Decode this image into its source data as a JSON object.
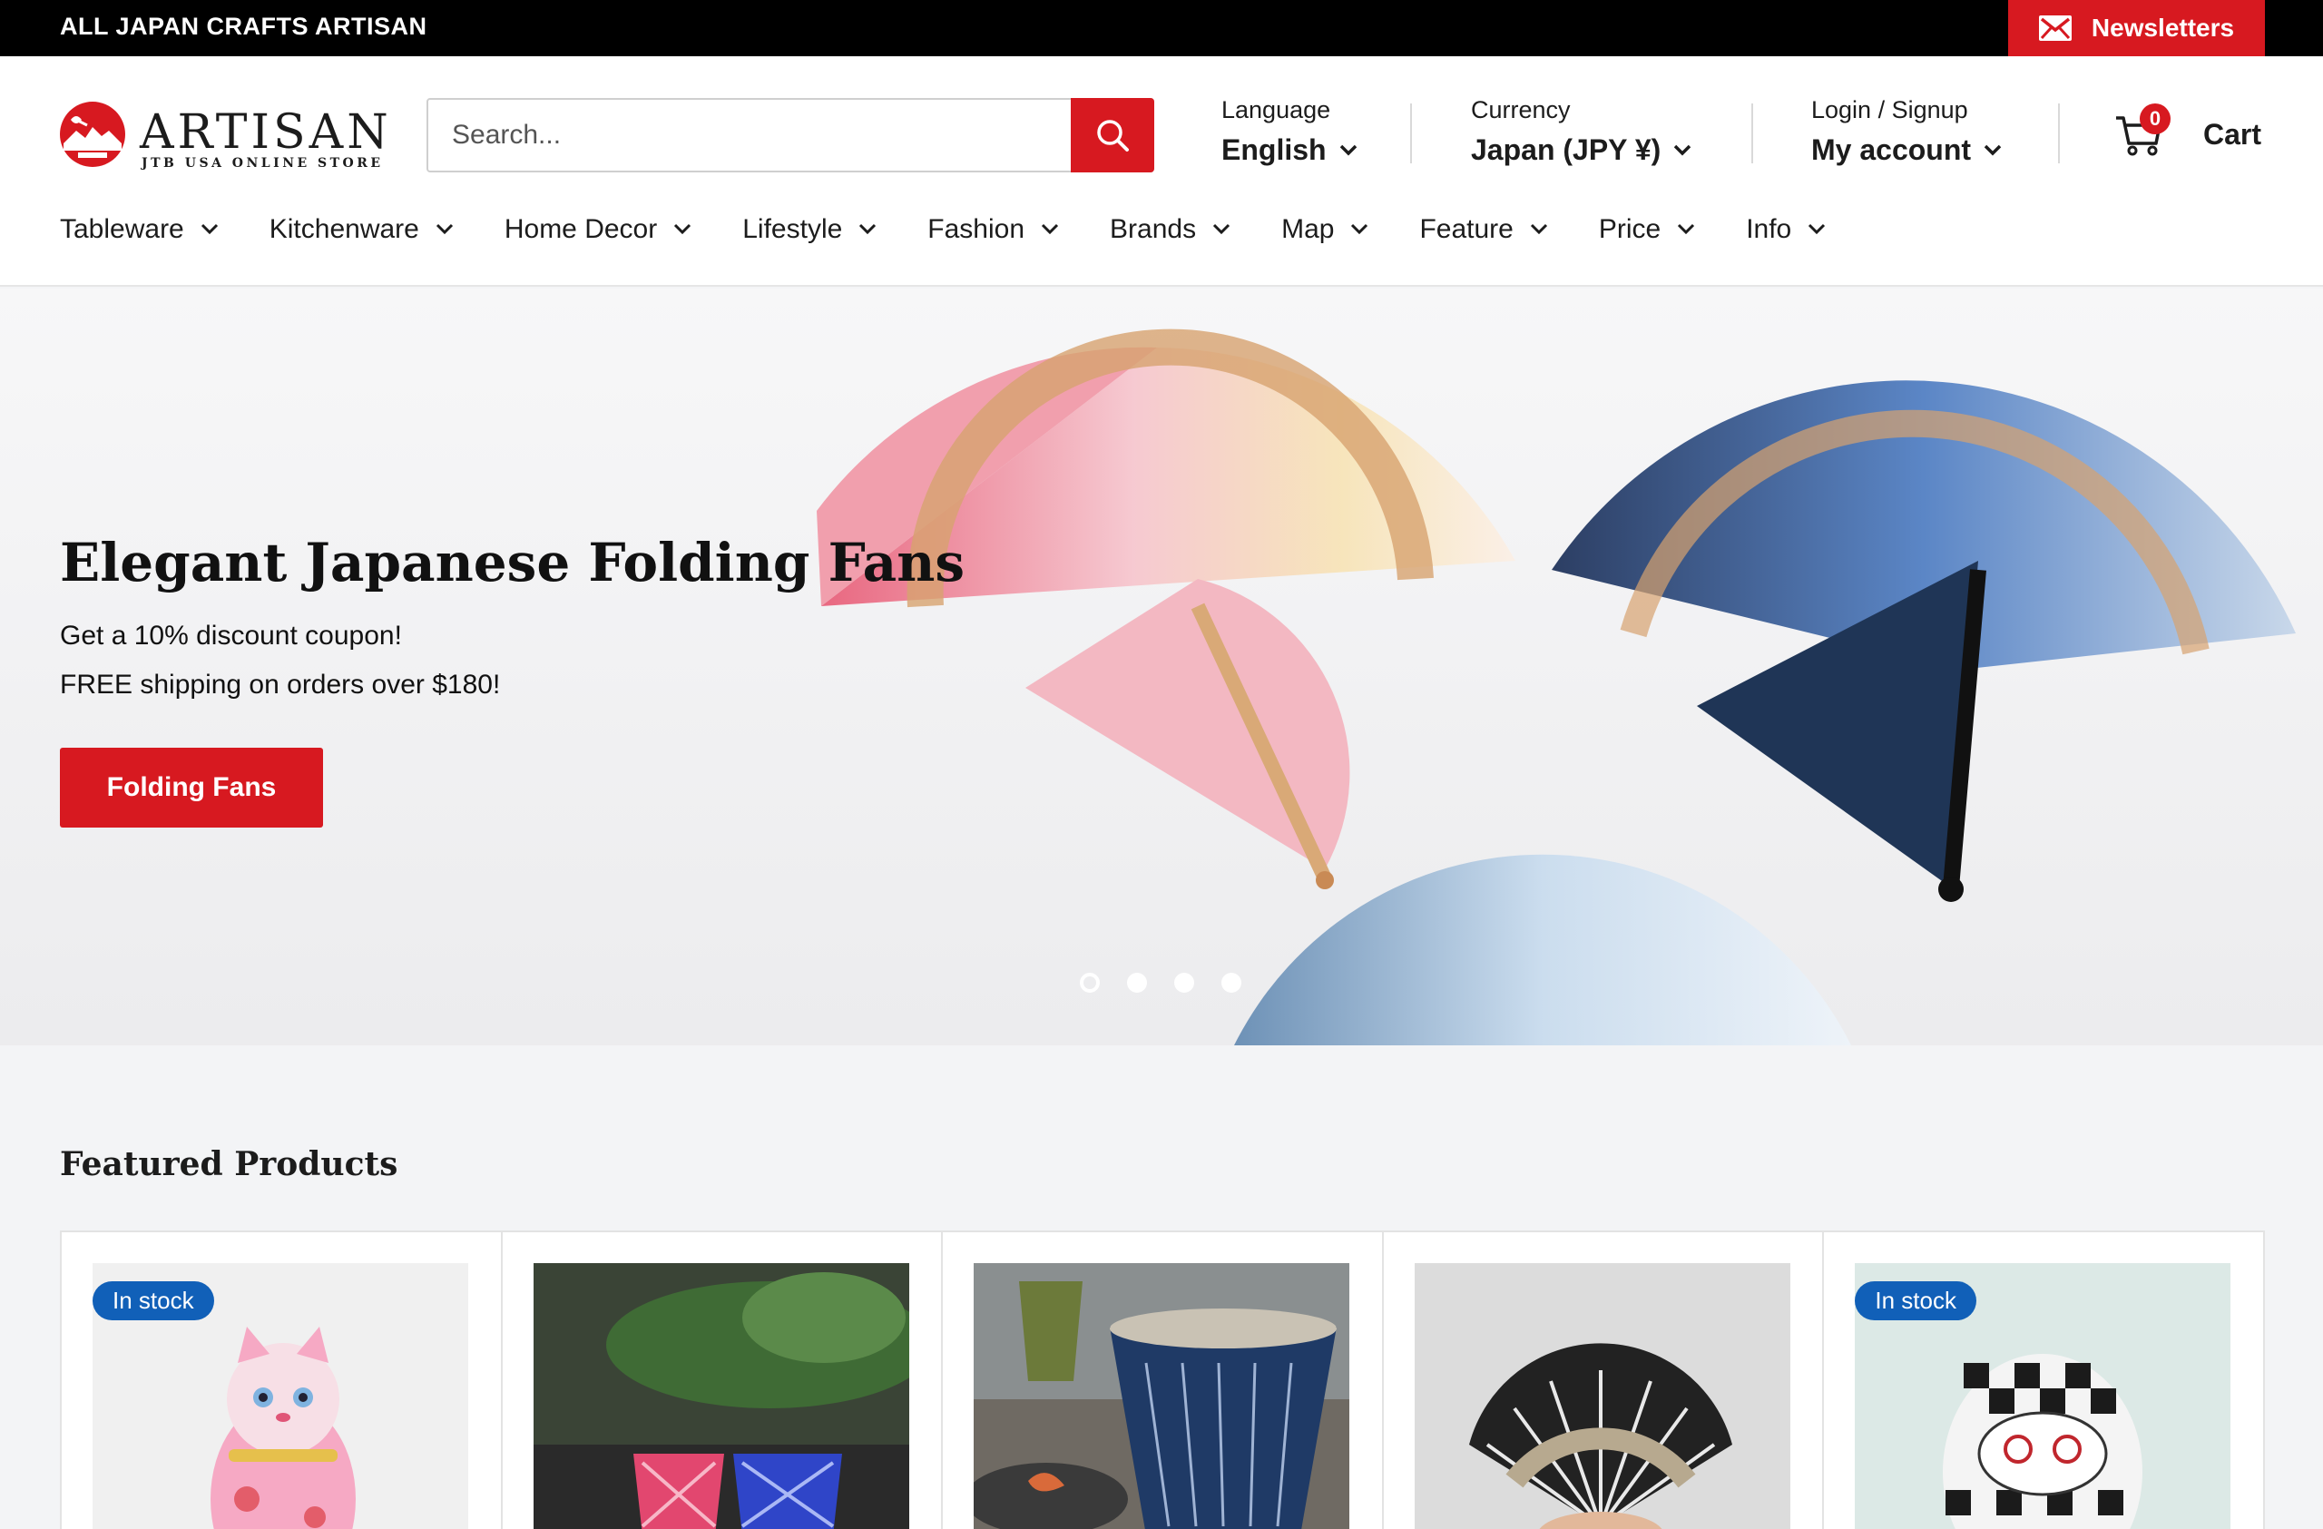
{
  "topbar": {
    "text": "ALL JAPAN CRAFTS ARTISAN",
    "newsletter_label": "Newsletters"
  },
  "logo": {
    "wordmark": "ARTISAN",
    "subtitle": "JTB USA ONLINE STORE"
  },
  "search": {
    "placeholder": "Search..."
  },
  "language": {
    "label": "Language",
    "value": "English"
  },
  "currency": {
    "label": "Currency",
    "value": "Japan (JPY ¥)"
  },
  "account": {
    "label": "Login / Signup",
    "value": "My account"
  },
  "cart": {
    "count": "0",
    "label": "Cart"
  },
  "nav": {
    "items": [
      {
        "label": "Tableware"
      },
      {
        "label": "Kitchenware"
      },
      {
        "label": "Home Decor"
      },
      {
        "label": "Lifestyle"
      },
      {
        "label": "Fashion"
      },
      {
        "label": "Brands"
      },
      {
        "label": "Map"
      },
      {
        "label": "Feature"
      },
      {
        "label": "Price"
      },
      {
        "label": "Info"
      }
    ]
  },
  "hero": {
    "title": "Elegant Japanese Folding Fans",
    "line1": "Get a 10% discount coupon!",
    "line2": "FREE shipping on orders over $180!",
    "cta": "Folding Fans",
    "slides": 4,
    "active_slide": 1
  },
  "featured": {
    "title": "Featured Products",
    "products": [
      {
        "badge": "In stock",
        "image": "maneki-neko-cat"
      },
      {
        "badge": "",
        "image": "kiriko-glasses"
      },
      {
        "badge": "",
        "image": "blue-ceramic-cup"
      },
      {
        "badge": "",
        "image": "black-folding-fan"
      },
      {
        "badge": "In stock",
        "image": "checkered-daruma"
      }
    ]
  },
  "colors": {
    "brand_red": "#d71920",
    "badge_blue": "#1160b8",
    "topbar": "#000000"
  }
}
